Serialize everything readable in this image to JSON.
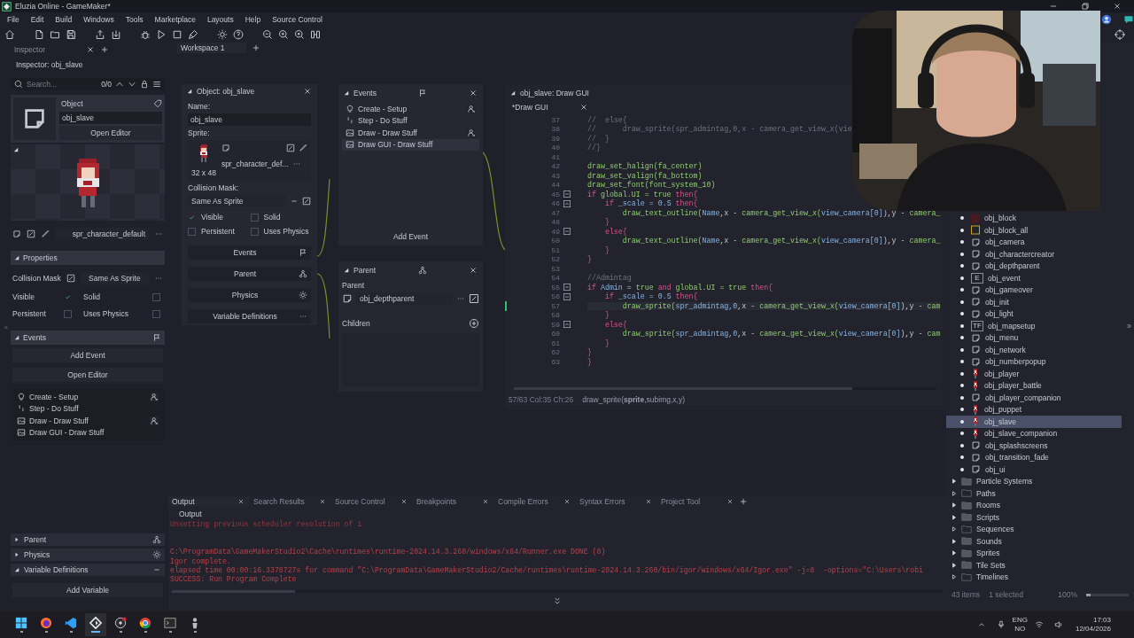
{
  "window": {
    "title": "Eluzia Online - GameMaker*"
  },
  "menu": [
    "File",
    "Edit",
    "Build",
    "Windows",
    "Tools",
    "Marketplace",
    "Layouts",
    "Help",
    "Source Control"
  ],
  "dock_tab": {
    "label": "Inspector"
  },
  "workspace_tab": {
    "label": "Workspace 1"
  },
  "inspector": {
    "title": "Inspector: obj_slave",
    "search": {
      "placeholder": "Search...",
      "count": "0/0"
    },
    "object": {
      "type_label": "Object",
      "name": "obj_slave",
      "open_editor": "Open Editor"
    },
    "sprite_name": "spr_character_default",
    "properties": {
      "header": "Properties",
      "expanded": true,
      "collision_label": "Collision Mask",
      "collision_value": "Same As Sprite",
      "checks": [
        {
          "label": "Visible",
          "checked": true
        },
        {
          "label": "Solid",
          "checked": false
        },
        {
          "label": "Persistent",
          "checked": false
        },
        {
          "label": "Uses Physics",
          "checked": false
        }
      ]
    },
    "events": {
      "header": "Events",
      "expanded": true,
      "add_event": "Add Event",
      "open_editor": "Open Editor",
      "items": [
        {
          "label": "Create - Setup",
          "kind": "create",
          "inherited": true
        },
        {
          "label": "Step - Do Stuff",
          "kind": "step",
          "inherited": false
        },
        {
          "label": "Draw - Draw Stuff",
          "kind": "draw",
          "inherited": true
        },
        {
          "label": "Draw GUI - Draw Stuff",
          "kind": "draw",
          "inherited": false
        }
      ]
    },
    "sections": [
      {
        "label": "Parent",
        "kind": "parent",
        "expanded": false
      },
      {
        "label": "Physics",
        "kind": "gear",
        "expanded": false
      },
      {
        "label": "Variable Definitions",
        "kind": "minus",
        "expanded": true
      }
    ],
    "add_variable": "Add Variable"
  },
  "object_panel": {
    "title": "Object: obj_slave",
    "name_label": "Name:",
    "name": "obj_slave",
    "sprite_label": "Sprite:",
    "sprite_name": "spr_character_def...",
    "sprite_size": "32 x 48",
    "collision_label": "Collision Mask:",
    "collision_value": "Same As Sprite",
    "checks": [
      {
        "label": "Visible",
        "checked": true
      },
      {
        "label": "Solid",
        "checked": false
      },
      {
        "label": "Persistent",
        "checked": false
      },
      {
        "label": "Uses Physics",
        "checked": false
      }
    ],
    "buttons": [
      {
        "label": "Events",
        "kind": "flag"
      },
      {
        "label": "Parent",
        "kind": "parent"
      },
      {
        "label": "Physics",
        "kind": "gear"
      },
      {
        "label": "Variable Definitions",
        "kind": "more"
      }
    ]
  },
  "events_panel": {
    "title": "Events",
    "add_event": "Add Event",
    "items": [
      {
        "label": "Create - Setup",
        "kind": "create",
        "inherited": true,
        "selected": false
      },
      {
        "label": "Step - Do Stuff",
        "kind": "step",
        "inherited": false,
        "selected": false
      },
      {
        "label": "Draw - Draw Stuff",
        "kind": "draw",
        "inherited": true,
        "selected": false
      },
      {
        "label": "Draw GUI - Draw Stuff",
        "kind": "draw",
        "inherited": false,
        "selected": true
      }
    ]
  },
  "parent_panel": {
    "title": "Parent",
    "parent_label": "Parent",
    "parent_name": "obj_depthparent",
    "children_label": "Children"
  },
  "code_editor": {
    "title": "obj_slave: Draw GUI",
    "tab": "*Draw GUI",
    "status": "57/63 Col:35 Ch:26",
    "signature": "draw_sprite(**sprite**,subimg,x,y)",
    "lines": [
      {
        "number": "37",
        "fold": false,
        "current": false,
        "segments": [
          {
            "kind": "comment",
            "t": "//  else{"
          }
        ]
      },
      {
        "number": "38",
        "fold": false,
        "current": false,
        "segments": [
          {
            "kind": "comment",
            "t": "//      draw_sprite(spr_admintag,0,x - camera_get_view_x(vie"
          }
        ]
      },
      {
        "number": "39",
        "fold": false,
        "current": false,
        "segments": [
          {
            "kind": "comment",
            "t": "//  }"
          }
        ]
      },
      {
        "number": "40",
        "fold": false,
        "current": false,
        "segments": [
          {
            "kind": "comment",
            "t": "//}"
          }
        ]
      },
      {
        "number": "41",
        "fold": false,
        "current": false
      },
      {
        "number": "42",
        "fold": false,
        "current": false,
        "segments": [
          {
            "kind": "function",
            "t": "draw_set_halign(fa_center)"
          }
        ]
      },
      {
        "number": "43",
        "fold": false,
        "current": false,
        "segments": [
          {
            "kind": "function",
            "t": "draw_set_valign(fa_bottom)"
          }
        ]
      },
      {
        "number": "44",
        "fold": false,
        "current": false,
        "segments": [
          {
            "kind": "function",
            "t": "draw_set_font(font_system_10)"
          }
        ]
      },
      {
        "number": "45",
        "fold": true,
        "current": false,
        "segments": [
          {
            "kind": "keyword",
            "t": "if "
          },
          {
            "kind": "function",
            "t": "global.UI = true "
          },
          {
            "kind": "keyword",
            "t": "then{"
          }
        ]
      },
      {
        "number": "46",
        "fold": true,
        "current": false,
        "segments": [
          {
            "kind": "keyword",
            "t": "    if "
          },
          {
            "kind": "variable",
            "t": "_scale = 0.5 "
          },
          {
            "kind": "keyword",
            "t": "then{"
          }
        ]
      },
      {
        "number": "47",
        "fold": false,
        "current": false,
        "segments": [
          {
            "kind": "function",
            "t": "        draw_text_outline("
          },
          {
            "kind": "variable",
            "t": "Name"
          },
          {
            "kind": "plain",
            "t": ",x - "
          },
          {
            "kind": "function",
            "t": "camera_get_view_x("
          },
          {
            "kind": "variable",
            "t": "view_camera[0]"
          },
          {
            "kind": "plain",
            "t": "),y - "
          },
          {
            "kind": "function",
            "t": "camera_"
          }
        ]
      },
      {
        "number": "48",
        "fold": false,
        "current": false,
        "segments": [
          {
            "kind": "keyword",
            "t": "    }"
          }
        ]
      },
      {
        "number": "49",
        "fold": true,
        "current": false,
        "segments": [
          {
            "kind": "keyword",
            "t": "    else{"
          }
        ]
      },
      {
        "number": "50",
        "fold": false,
        "current": false,
        "segments": [
          {
            "kind": "function",
            "t": "        draw_text_outline("
          },
          {
            "kind": "variable",
            "t": "Name"
          },
          {
            "kind": "plain",
            "t": ",x - "
          },
          {
            "kind": "function",
            "t": "camera_get_view_x("
          },
          {
            "kind": "variable",
            "t": "view_camera[0]"
          },
          {
            "kind": "plain",
            "t": "),y - "
          },
          {
            "kind": "function",
            "t": "camera_"
          }
        ]
      },
      {
        "number": "51",
        "fold": false,
        "current": false,
        "segments": [
          {
            "kind": "keyword",
            "t": "    }"
          }
        ]
      },
      {
        "number": "52",
        "fold": false,
        "current": false,
        "segments": [
          {
            "kind": "keyword",
            "t": "}"
          }
        ]
      },
      {
        "number": "53",
        "fold": false,
        "current": false
      },
      {
        "number": "54",
        "fold": false,
        "current": false,
        "segments": [
          {
            "kind": "comment",
            "t": "//Admintag"
          }
        ]
      },
      {
        "number": "55",
        "fold": true,
        "current": false,
        "segments": [
          {
            "kind": "keyword",
            "t": "if "
          },
          {
            "kind": "variable",
            "t": "Admin "
          },
          {
            "kind": "plain",
            "t": "= "
          },
          {
            "kind": "function",
            "t": "true "
          },
          {
            "kind": "keyword",
            "t": "and "
          },
          {
            "kind": "function",
            "t": "global.UI = true "
          },
          {
            "kind": "keyword",
            "t": "then{"
          }
        ]
      },
      {
        "number": "56",
        "fold": true,
        "current": false,
        "segments": [
          {
            "kind": "keyword",
            "t": "    if "
          },
          {
            "kind": "variable",
            "t": "_scale = 0.5 "
          },
          {
            "kind": "keyword",
            "t": "then{"
          }
        ]
      },
      {
        "number": "57",
        "fold": false,
        "current": true,
        "segments": [
          {
            "kind": "function",
            "t": "        draw_sprite("
          },
          {
            "kind": "variable",
            "t": "spr_admintag,0"
          },
          {
            "kind": "plain",
            "t": ",x - "
          },
          {
            "kind": "function",
            "t": "camera_get_view_x("
          },
          {
            "kind": "variable",
            "t": "view_camera[0]"
          },
          {
            "kind": "plain",
            "t": "),y - "
          },
          {
            "kind": "function",
            "t": "cam"
          }
        ]
      },
      {
        "number": "58",
        "fold": false,
        "current": false,
        "segments": [
          {
            "kind": "keyword",
            "t": "    }"
          }
        ]
      },
      {
        "number": "59",
        "fold": true,
        "current": false,
        "segments": [
          {
            "kind": "keyword",
            "t": "    else{"
          }
        ]
      },
      {
        "number": "60",
        "fold": false,
        "current": false,
        "segments": [
          {
            "kind": "function",
            "t": "        draw_sprite("
          },
          {
            "kind": "variable",
            "t": "spr_admintag,0"
          },
          {
            "kind": "plain",
            "t": ",x - "
          },
          {
            "kind": "function",
            "t": "camera_get_view_x("
          },
          {
            "kind": "variable",
            "t": "view_camera[0]"
          },
          {
            "kind": "plain",
            "t": "),y - "
          },
          {
            "kind": "function",
            "t": "cam"
          }
        ]
      },
      {
        "number": "61",
        "fold": false,
        "current": false,
        "segments": [
          {
            "kind": "keyword",
            "t": "    }"
          }
        ]
      },
      {
        "number": "62",
        "fold": false,
        "current": false,
        "segments": [
          {
            "kind": "keyword",
            "t": "}"
          }
        ]
      },
      {
        "number": "63",
        "fold": false,
        "current": false,
        "segments": [
          {
            "kind": "keyword",
            "t": "}"
          }
        ]
      }
    ]
  },
  "asset_browser": {
    "items": [
      {
        "name": "obj_block",
        "kind": "block",
        "selected": false
      },
      {
        "name": "obj_block_all",
        "kind": "block_all",
        "selected": false
      },
      {
        "name": "obj_camera",
        "kind": "object",
        "selected": false
      },
      {
        "name": "obj_charactercreator",
        "kind": "object",
        "selected": false
      },
      {
        "name": "obj_depthparent",
        "kind": "object",
        "selected": false
      },
      {
        "name": "obj_event",
        "kind": "letter",
        "icon_text": "E",
        "selected": false
      },
      {
        "name": "obj_gameover",
        "kind": "object",
        "selected": false
      },
      {
        "name": "obj_init",
        "kind": "object",
        "selected": false
      },
      {
        "name": "obj_light",
        "kind": "object",
        "selected": false
      },
      {
        "name": "obj_mapsetup",
        "kind": "letter",
        "icon_text": "TF",
        "selected": false
      },
      {
        "name": "obj_menu",
        "kind": "object",
        "selected": false
      },
      {
        "name": "obj_network",
        "kind": "object",
        "selected": false
      },
      {
        "name": "obj_numberpopup",
        "kind": "object",
        "selected": false
      },
      {
        "name": "obj_player",
        "kind": "sprite",
        "selected": false
      },
      {
        "name": "obj_player_battle",
        "kind": "sprite",
        "selected": false
      },
      {
        "name": "obj_player_companion",
        "kind": "object",
        "selected": false
      },
      {
        "name": "obj_puppet",
        "kind": "sprite",
        "selected": false
      },
      {
        "name": "obj_slave",
        "kind": "sprite",
        "selected": true
      },
      {
        "name": "obj_slave_companion",
        "kind": "sprite",
        "selected": false
      },
      {
        "name": "obj_splashscreens",
        "kind": "object",
        "selected": false
      },
      {
        "name": "obj_transition_fade",
        "kind": "object",
        "selected": false
      },
      {
        "name": "obj_ui",
        "kind": "object",
        "selected": false
      }
    ],
    "folders": [
      {
        "name": "Particle Systems",
        "has_items": true
      },
      {
        "name": "Paths",
        "has_items": false
      },
      {
        "name": "Rooms",
        "has_items": true
      },
      {
        "name": "Scripts",
        "has_items": true
      },
      {
        "name": "Sequences",
        "has_items": false
      },
      {
        "name": "Sounds",
        "has_items": true
      },
      {
        "name": "Sprites",
        "has_items": true
      },
      {
        "name": "Tile Sets",
        "has_items": true
      },
      {
        "name": "Timelines",
        "has_items": false
      }
    ],
    "footer": {
      "count": "43 items",
      "selection": "1 selected",
      "zoom": "100%",
      "level": 0.1
    }
  },
  "output": {
    "tabs": [
      {
        "label": "Output",
        "selected": true
      },
      {
        "label": "Search Results",
        "selected": false
      },
      {
        "label": "Source Control",
        "selected": false
      },
      {
        "label": "Breakpoints",
        "selected": false
      },
      {
        "label": "Compile Errors",
        "selected": false
      },
      {
        "label": "Syntax Errors",
        "selected": false
      },
      {
        "label": "Project Tool",
        "selected": false
      }
    ],
    "header": "Output",
    "blocks": [
      {
        "lines": [
          "Unsetting previous scheduler resolution of 1"
        ]
      },
      {
        "lines": [
          "C:\\ProgramData\\GameMakerStudio2\\Cache\\runtimes\\runtime-2024.14.3.260/windows/x64/Runner.exe DONE (0)",
          "Igor complete.",
          "elapsed time 00:00:16.3378727s for command \"C:\\ProgramData\\GameMakerStudio2/Cache/runtimes\\runtime-2024.14.3.260/bin/igor/windows/x64/Igor.exe\" -j=8  -options=\"C:\\Users\\robi",
          "SUCCESS: Run Program Complete"
        ]
      }
    ]
  },
  "taskbar": {
    "apps": [
      {
        "kind": "start",
        "selected": false
      },
      {
        "kind": "firefox",
        "selected": false
      },
      {
        "kind": "vscode",
        "selected": false
      },
      {
        "kind": "gamemaker",
        "selected": true
      },
      {
        "kind": "obs",
        "selected": false
      },
      {
        "kind": "chrome",
        "selected": false
      },
      {
        "kind": "terminal",
        "selected": false
      },
      {
        "kind": "figure",
        "selected": false
      }
    ],
    "language": "ENG",
    "layout": "NO",
    "time": "17:03",
    "date": "12/04/2026"
  }
}
